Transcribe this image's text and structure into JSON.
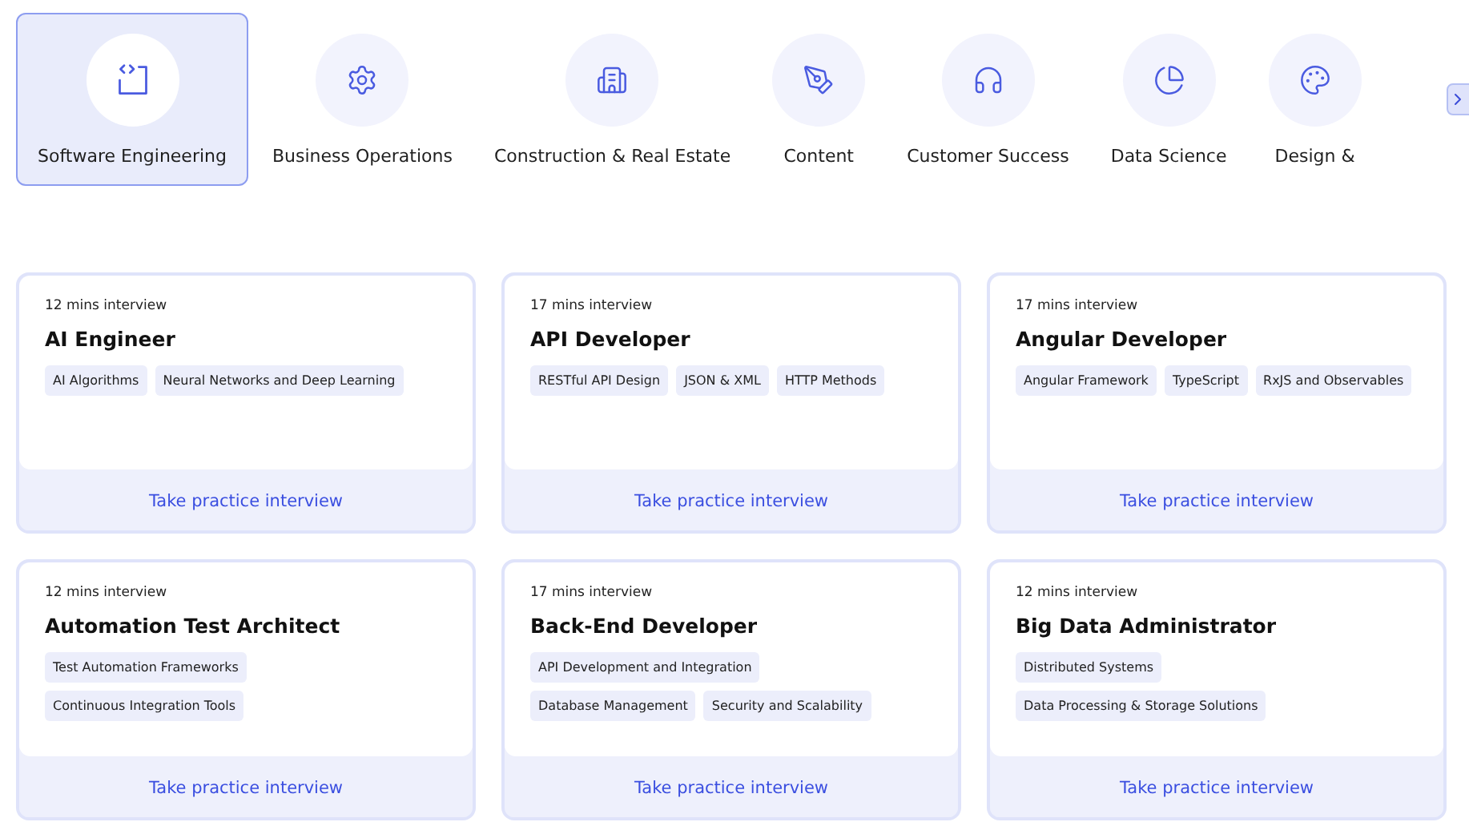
{
  "categories": [
    {
      "label": "Software Engineering",
      "selected": true
    },
    {
      "label": "Business Operations",
      "selected": false
    },
    {
      "label": "Construction & Real Estate",
      "selected": false
    },
    {
      "label": "Content",
      "selected": false
    },
    {
      "label": "Customer Success",
      "selected": false
    },
    {
      "label": "Data Science",
      "selected": false
    },
    {
      "label": "Design &",
      "selected": false
    }
  ],
  "cards": [
    {
      "duration": "12 mins interview",
      "title": "AI Engineer",
      "tags": [
        "AI Algorithms",
        "Neural Networks and Deep Learning"
      ],
      "action": "Take practice interview"
    },
    {
      "duration": "17 mins interview",
      "title": "API Developer",
      "tags": [
        "RESTful API Design",
        "JSON & XML",
        "HTTP Methods"
      ],
      "action": "Take practice interview"
    },
    {
      "duration": "17 mins interview",
      "title": "Angular Developer",
      "tags": [
        "Angular Framework",
        "TypeScript",
        "RxJS and Observables"
      ],
      "action": "Take practice interview"
    },
    {
      "duration": "12 mins interview",
      "title": "Automation Test Architect",
      "tags": [
        "Test Automation Frameworks",
        "Continuous Integration Tools"
      ],
      "action": "Take practice interview"
    },
    {
      "duration": "17 mins interview",
      "title": "Back-End Developer",
      "tags": [
        "API Development and Integration",
        "Database Management",
        "Security and Scalability"
      ],
      "action": "Take practice interview"
    },
    {
      "duration": "12 mins interview",
      "title": "Big Data Administrator",
      "tags": [
        "Distributed Systems",
        "Data Processing & Storage Solutions"
      ],
      "action": "Take practice interview"
    }
  ]
}
